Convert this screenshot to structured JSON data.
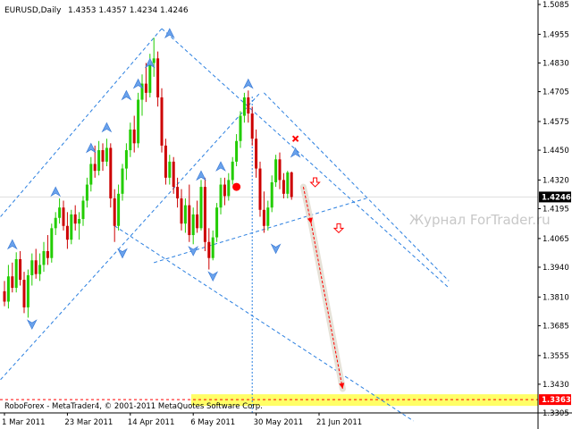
{
  "chart_data": {
    "type": "candlestick",
    "header": {
      "symbol": "EURUSD,Daily",
      "ohlc": "1.4353 1.4357 1.4234 1.4246"
    },
    "ylim": [
      1.3305,
      1.5085
    ],
    "y_ticks": [
      "1.5085",
      "1.4955",
      "1.4830",
      "1.4705",
      "1.4575",
      "1.4450",
      "1.4320",
      "1.4195",
      "1.4065",
      "1.3940",
      "1.3810",
      "1.3685",
      "1.3555",
      "1.3430",
      "1.3305"
    ],
    "x_ticks": [
      {
        "label": "1 Mar 2011",
        "bar": 0
      },
      {
        "label": "23 Mar 2011",
        "bar": 16
      },
      {
        "label": "14 Apr 2011",
        "bar": 32
      },
      {
        "label": "6 May 2011",
        "bar": 48
      },
      {
        "label": "30 May 2011",
        "bar": 64
      },
      {
        "label": "21 Jun 2011",
        "bar": 80
      }
    ],
    "current_price": {
      "value": 1.4246,
      "label": "1.4246"
    },
    "target_price": {
      "value": 1.3363,
      "label": "1.3363"
    },
    "watermark": "Журнал ForTrader.ru",
    "copyright": "RoboForex - MetaTrader4, © 2001-2011 MetaQuotes Software Corp.",
    "colors": {
      "bull": "#22cc00",
      "bear": "#cc0000",
      "trend": "#2a7fe0",
      "target_zone": "#ffff66",
      "target_label_bg": "#ff0000",
      "current_label_bg": "#000000",
      "arrow": "#ff0000"
    },
    "candles": [
      {
        "o": 1.3835,
        "h": 1.388,
        "l": 1.377,
        "c": 1.379
      },
      {
        "o": 1.379,
        "h": 1.395,
        "l": 1.376,
        "c": 1.39
      },
      {
        "o": 1.39,
        "h": 1.396,
        "l": 1.383,
        "c": 1.385
      },
      {
        "o": 1.385,
        "h": 1.4005,
        "l": 1.383,
        "c": 1.3975
      },
      {
        "o": 1.3975,
        "h": 1.401,
        "l": 1.386,
        "c": 1.3885
      },
      {
        "o": 1.3885,
        "h": 1.392,
        "l": 1.374,
        "c": 1.3765
      },
      {
        "o": 1.3765,
        "h": 1.393,
        "l": 1.372,
        "c": 1.3905
      },
      {
        "o": 1.3905,
        "h": 1.4,
        "l": 1.386,
        "c": 1.397
      },
      {
        "o": 1.397,
        "h": 1.402,
        "l": 1.389,
        "c": 1.391
      },
      {
        "o": 1.391,
        "h": 1.4,
        "l": 1.388,
        "c": 1.395
      },
      {
        "o": 1.395,
        "h": 1.405,
        "l": 1.392,
        "c": 1.401
      },
      {
        "o": 1.401,
        "h": 1.408,
        "l": 1.395,
        "c": 1.398
      },
      {
        "o": 1.398,
        "h": 1.413,
        "l": 1.396,
        "c": 1.411
      },
      {
        "o": 1.411,
        "h": 1.418,
        "l": 1.408,
        "c": 1.4155
      },
      {
        "o": 1.4155,
        "h": 1.424,
        "l": 1.413,
        "c": 1.42
      },
      {
        "o": 1.42,
        "h": 1.423,
        "l": 1.41,
        "c": 1.412
      },
      {
        "o": 1.412,
        "h": 1.418,
        "l": 1.402,
        "c": 1.406
      },
      {
        "o": 1.406,
        "h": 1.419,
        "l": 1.404,
        "c": 1.417
      },
      {
        "o": 1.417,
        "h": 1.421,
        "l": 1.41,
        "c": 1.413
      },
      {
        "o": 1.413,
        "h": 1.418,
        "l": 1.406,
        "c": 1.415
      },
      {
        "o": 1.415,
        "h": 1.425,
        "l": 1.412,
        "c": 1.423
      },
      {
        "o": 1.423,
        "h": 1.433,
        "l": 1.42,
        "c": 1.43
      },
      {
        "o": 1.43,
        "h": 1.442,
        "l": 1.427,
        "c": 1.439
      },
      {
        "o": 1.439,
        "h": 1.447,
        "l": 1.433,
        "c": 1.436
      },
      {
        "o": 1.436,
        "h": 1.449,
        "l": 1.434,
        "c": 1.445
      },
      {
        "o": 1.445,
        "h": 1.448,
        "l": 1.436,
        "c": 1.44
      },
      {
        "o": 1.44,
        "h": 1.45,
        "l": 1.438,
        "c": 1.446
      },
      {
        "o": 1.446,
        "h": 1.448,
        "l": 1.42,
        "c": 1.424
      },
      {
        "o": 1.424,
        "h": 1.428,
        "l": 1.405,
        "c": 1.412
      },
      {
        "o": 1.412,
        "h": 1.43,
        "l": 1.41,
        "c": 1.426
      },
      {
        "o": 1.426,
        "h": 1.439,
        "l": 1.423,
        "c": 1.437
      },
      {
        "o": 1.437,
        "h": 1.448,
        "l": 1.432,
        "c": 1.445
      },
      {
        "o": 1.445,
        "h": 1.457,
        "l": 1.442,
        "c": 1.454
      },
      {
        "o": 1.454,
        "h": 1.46,
        "l": 1.444,
        "c": 1.448
      },
      {
        "o": 1.448,
        "h": 1.47,
        "l": 1.446,
        "c": 1.467
      },
      {
        "o": 1.467,
        "h": 1.478,
        "l": 1.46,
        "c": 1.474
      },
      {
        "o": 1.474,
        "h": 1.483,
        "l": 1.466,
        "c": 1.47
      },
      {
        "o": 1.47,
        "h": 1.487,
        "l": 1.468,
        "c": 1.483
      },
      {
        "o": 1.483,
        "h": 1.494,
        "l": 1.477,
        "c": 1.485
      },
      {
        "o": 1.485,
        "h": 1.488,
        "l": 1.464,
        "c": 1.468
      },
      {
        "o": 1.468,
        "h": 1.472,
        "l": 1.444,
        "c": 1.447
      },
      {
        "o": 1.447,
        "h": 1.45,
        "l": 1.43,
        "c": 1.433
      },
      {
        "o": 1.433,
        "h": 1.443,
        "l": 1.43,
        "c": 1.44
      },
      {
        "o": 1.44,
        "h": 1.442,
        "l": 1.426,
        "c": 1.429
      },
      {
        "o": 1.429,
        "h": 1.433,
        "l": 1.42,
        "c": 1.424
      },
      {
        "o": 1.424,
        "h": 1.428,
        "l": 1.41,
        "c": 1.413
      },
      {
        "o": 1.413,
        "h": 1.424,
        "l": 1.409,
        "c": 1.421
      },
      {
        "o": 1.421,
        "h": 1.43,
        "l": 1.405,
        "c": 1.408
      },
      {
        "o": 1.408,
        "h": 1.42,
        "l": 1.404,
        "c": 1.417
      },
      {
        "o": 1.417,
        "h": 1.423,
        "l": 1.409,
        "c": 1.411
      },
      {
        "o": 1.411,
        "h": 1.432,
        "l": 1.41,
        "c": 1.429
      },
      {
        "o": 1.429,
        "h": 1.433,
        "l": 1.401,
        "c": 1.405
      },
      {
        "o": 1.405,
        "h": 1.411,
        "l": 1.393,
        "c": 1.398
      },
      {
        "o": 1.398,
        "h": 1.41,
        "l": 1.397,
        "c": 1.407
      },
      {
        "o": 1.407,
        "h": 1.422,
        "l": 1.405,
        "c": 1.42
      },
      {
        "o": 1.42,
        "h": 1.433,
        "l": 1.417,
        "c": 1.43
      },
      {
        "o": 1.43,
        "h": 1.433,
        "l": 1.421,
        "c": 1.425
      },
      {
        "o": 1.425,
        "h": 1.435,
        "l": 1.423,
        "c": 1.432
      },
      {
        "o": 1.432,
        "h": 1.442,
        "l": 1.43,
        "c": 1.44
      },
      {
        "o": 1.44,
        "h": 1.452,
        "l": 1.438,
        "c": 1.449
      },
      {
        "o": 1.449,
        "h": 1.462,
        "l": 1.446,
        "c": 1.46
      },
      {
        "o": 1.46,
        "h": 1.47,
        "l": 1.457,
        "c": 1.468
      },
      {
        "o": 1.468,
        "h": 1.471,
        "l": 1.457,
        "c": 1.461
      },
      {
        "o": 1.461,
        "h": 1.464,
        "l": 1.447,
        "c": 1.45
      },
      {
        "o": 1.45,
        "h": 1.454,
        "l": 1.433,
        "c": 1.437
      },
      {
        "o": 1.437,
        "h": 1.44,
        "l": 1.416,
        "c": 1.419
      },
      {
        "o": 1.419,
        "h": 1.427,
        "l": 1.409,
        "c": 1.412
      },
      {
        "o": 1.412,
        "h": 1.423,
        "l": 1.41,
        "c": 1.42
      },
      {
        "o": 1.42,
        "h": 1.434,
        "l": 1.418,
        "c": 1.431
      },
      {
        "o": 1.431,
        "h": 1.443,
        "l": 1.429,
        "c": 1.441
      },
      {
        "o": 1.441,
        "h": 1.444,
        "l": 1.428,
        "c": 1.432
      },
      {
        "o": 1.432,
        "h": 1.435,
        "l": 1.424,
        "c": 1.426
      },
      {
        "o": 1.426,
        "h": 1.436,
        "l": 1.424,
        "c": 1.4353
      },
      {
        "o": 1.4353,
        "h": 1.4357,
        "l": 1.4234,
        "c": 1.4246
      }
    ],
    "trendlines": [
      {
        "from": {
          "bar": -1,
          "value": 1.416
        },
        "to": {
          "bar": 40,
          "value": 1.498
        }
      },
      {
        "from": {
          "bar": -1,
          "value": 1.345
        },
        "to": {
          "bar": 65,
          "value": 1.47
        }
      },
      {
        "from": {
          "bar": 40,
          "value": 1.498
        },
        "to": {
          "bar": 113,
          "value": 1.385
        }
      },
      {
        "from": {
          "bar": 28,
          "value": 1.412
        },
        "to": {
          "bar": 104,
          "value": 1.327
        }
      },
      {
        "from": {
          "bar": 66,
          "value": 1.47
        },
        "to": {
          "bar": 113,
          "value": 1.388
        }
      },
      {
        "from": {
          "bar": 38,
          "value": 1.396
        },
        "to": {
          "bar": 92,
          "value": 1.424
        }
      }
    ],
    "vertical_line": {
      "bar": 63
    },
    "fractals_up": [
      {
        "bar": 2,
        "value": 1.404
      },
      {
        "bar": 13,
        "value": 1.427
      },
      {
        "bar": 22,
        "value": 1.446
      },
      {
        "bar": 26,
        "value": 1.455
      },
      {
        "bar": 31,
        "value": 1.469
      },
      {
        "bar": 34,
        "value": 1.474
      },
      {
        "bar": 37,
        "value": 1.483
      },
      {
        "bar": 42,
        "value": 1.496
      },
      {
        "bar": 50,
        "value": 1.434
      },
      {
        "bar": 55,
        "value": 1.438
      },
      {
        "bar": 62,
        "value": 1.474
      },
      {
        "bar": 74,
        "value": 1.444
      }
    ],
    "fractals_down": [
      {
        "bar": 7,
        "value": 1.369
      },
      {
        "bar": 30,
        "value": 1.4
      },
      {
        "bar": 48,
        "value": 1.401
      },
      {
        "bar": 53,
        "value": 1.39
      },
      {
        "bar": 69,
        "value": 1.402
      }
    ],
    "hollow_arrows": [
      {
        "bar": 79,
        "value": 1.431
      },
      {
        "bar": 85,
        "value": 1.411
      }
    ],
    "marker_x": {
      "bar": 74,
      "value": 1.45
    },
    "marker_dot": {
      "bar": 59,
      "value": 1.429
    },
    "forecast_path": [
      {
        "bar": 76,
        "value": 1.429
      },
      {
        "bar": 78,
        "value": 1.413
      },
      {
        "bar": 86,
        "value": 1.341
      }
    ]
  }
}
